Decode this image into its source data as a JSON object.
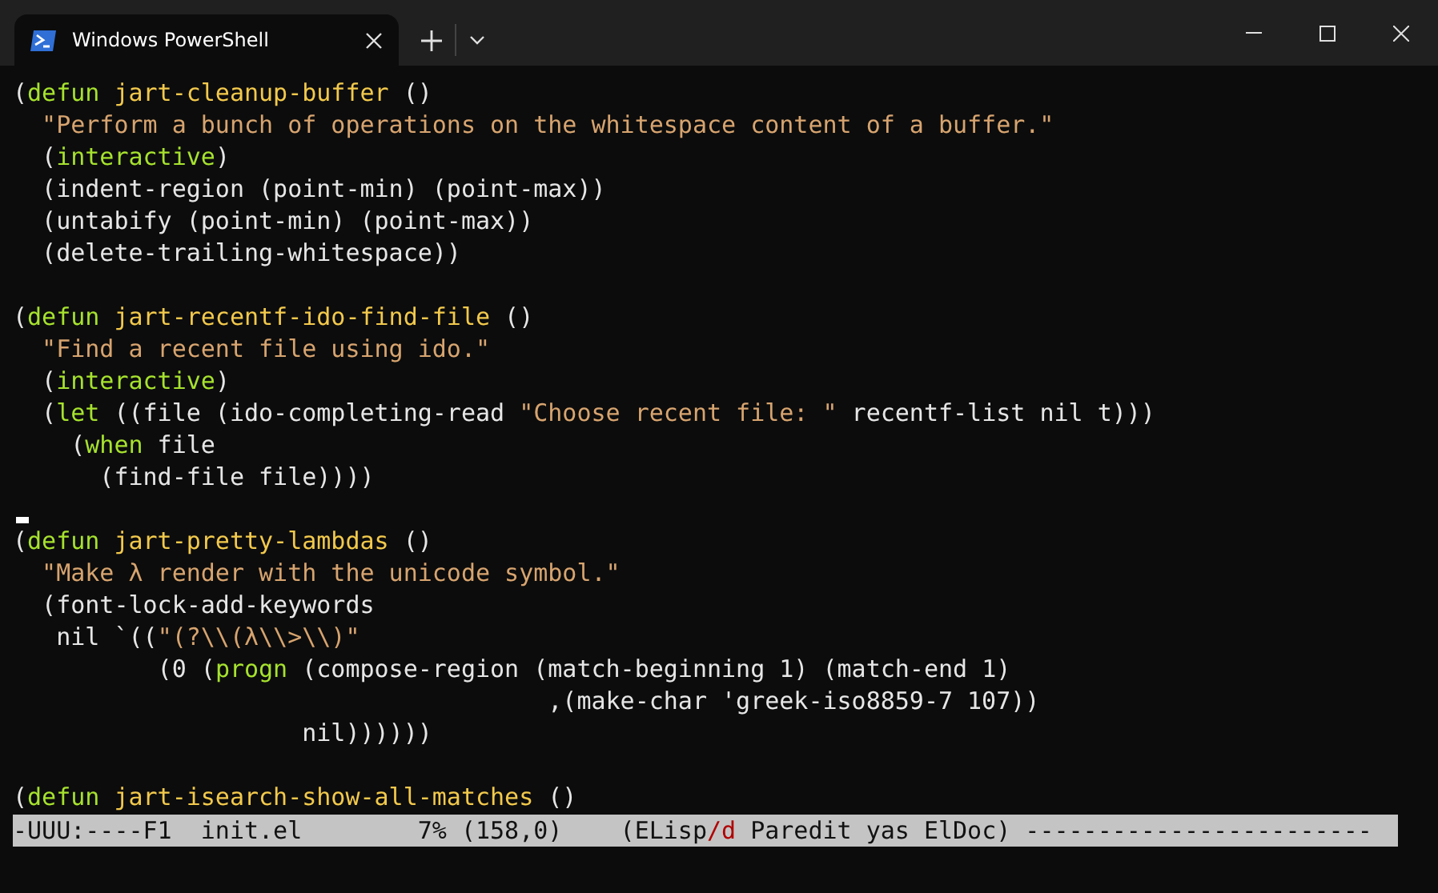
{
  "window": {
    "tab": {
      "title": "Windows PowerShell",
      "selected": true
    }
  },
  "editor": {
    "lines": [
      {
        "kind": "code",
        "segments": [
          {
            "kind": "plain",
            "text": "("
          },
          {
            "kind": "keyword",
            "text": "defun"
          },
          {
            "kind": "function",
            "text": " jart-cleanup-buffer"
          },
          {
            "kind": "plain",
            "text": " ()"
          }
        ]
      },
      {
        "kind": "code",
        "segments": [
          {
            "kind": "string",
            "text": "  \"Perform a bunch of operations on the whitespace content of a buffer.\""
          }
        ]
      },
      {
        "kind": "code",
        "segments": [
          {
            "kind": "plain",
            "text": "  ("
          },
          {
            "kind": "keyword",
            "text": "interactive"
          },
          {
            "kind": "plain",
            "text": ")"
          }
        ]
      },
      {
        "kind": "code",
        "segments": [
          {
            "kind": "plain",
            "text": "  (indent-region (point-min) (point-max))"
          }
        ]
      },
      {
        "kind": "code",
        "segments": [
          {
            "kind": "plain",
            "text": "  (untabify (point-min) (point-max))"
          }
        ]
      },
      {
        "kind": "code",
        "segments": [
          {
            "kind": "plain",
            "text": "  (delete-trailing-whitespace))"
          }
        ]
      },
      {
        "kind": "blank"
      },
      {
        "kind": "code",
        "segments": [
          {
            "kind": "plain",
            "text": "("
          },
          {
            "kind": "keyword",
            "text": "defun"
          },
          {
            "kind": "function",
            "text": " jart-recentf-ido-find-file"
          },
          {
            "kind": "plain",
            "text": " ()"
          }
        ]
      },
      {
        "kind": "code",
        "segments": [
          {
            "kind": "string",
            "text": "  \"Find a recent file using ido.\""
          }
        ]
      },
      {
        "kind": "code",
        "segments": [
          {
            "kind": "plain",
            "text": "  ("
          },
          {
            "kind": "keyword",
            "text": "interactive"
          },
          {
            "kind": "plain",
            "text": ")"
          }
        ]
      },
      {
        "kind": "code",
        "segments": [
          {
            "kind": "plain",
            "text": "  ("
          },
          {
            "kind": "keyword",
            "text": "let"
          },
          {
            "kind": "plain",
            "text": " ((file (ido-completing-read "
          },
          {
            "kind": "string",
            "text": "\"Choose recent file: \""
          },
          {
            "kind": "plain",
            "text": " recentf-list nil t)))"
          }
        ]
      },
      {
        "kind": "code",
        "segments": [
          {
            "kind": "plain",
            "text": "    ("
          },
          {
            "kind": "keyword",
            "text": "when"
          },
          {
            "kind": "plain",
            "text": " file"
          }
        ]
      },
      {
        "kind": "code",
        "segments": [
          {
            "kind": "plain",
            "text": "      (find-file file))))"
          }
        ]
      },
      {
        "kind": "blank",
        "cursor": true
      },
      {
        "kind": "code",
        "segments": [
          {
            "kind": "plain",
            "text": "("
          },
          {
            "kind": "keyword",
            "text": "defun"
          },
          {
            "kind": "function",
            "text": " jart-pretty-lambdas"
          },
          {
            "kind": "plain",
            "text": " ()"
          }
        ]
      },
      {
        "kind": "code",
        "segments": [
          {
            "kind": "string",
            "text": "  \"Make λ render with the unicode symbol.\""
          }
        ]
      },
      {
        "kind": "code",
        "segments": [
          {
            "kind": "plain",
            "text": "  (font-lock-add-keywords"
          }
        ]
      },
      {
        "kind": "code",
        "segments": [
          {
            "kind": "plain",
            "text": "   nil `(("
          },
          {
            "kind": "string",
            "text": "\"(?\\\\(λ\\\\>\\\\)\""
          }
        ]
      },
      {
        "kind": "code",
        "segments": [
          {
            "kind": "plain",
            "text": "          (0 ("
          },
          {
            "kind": "keyword",
            "text": "progn"
          },
          {
            "kind": "plain",
            "text": " (compose-region (match-beginning 1) (match-end 1)"
          }
        ]
      },
      {
        "kind": "code",
        "segments": [
          {
            "kind": "plain",
            "text": "                                     ,(make-char 'greek-iso8859-7 107))"
          }
        ]
      },
      {
        "kind": "code",
        "segments": [
          {
            "kind": "plain",
            "text": "                    nil))))))"
          }
        ]
      },
      {
        "kind": "blank"
      },
      {
        "kind": "code",
        "segments": [
          {
            "kind": "plain",
            "text": "("
          },
          {
            "kind": "keyword",
            "text": "defun"
          },
          {
            "kind": "function",
            "text": " jart-isearch-show-all-matches"
          },
          {
            "kind": "plain",
            "text": " ()"
          }
        ]
      }
    ],
    "mode_line": [
      {
        "kind": "plain",
        "text": "-UUU:----F1  init.el        7% (158,0)    (ELisp"
      },
      {
        "kind": "warning",
        "text": "/d"
      },
      {
        "kind": "plain",
        "text": " Paredit yas ElDoc) ------------------------"
      }
    ]
  }
}
